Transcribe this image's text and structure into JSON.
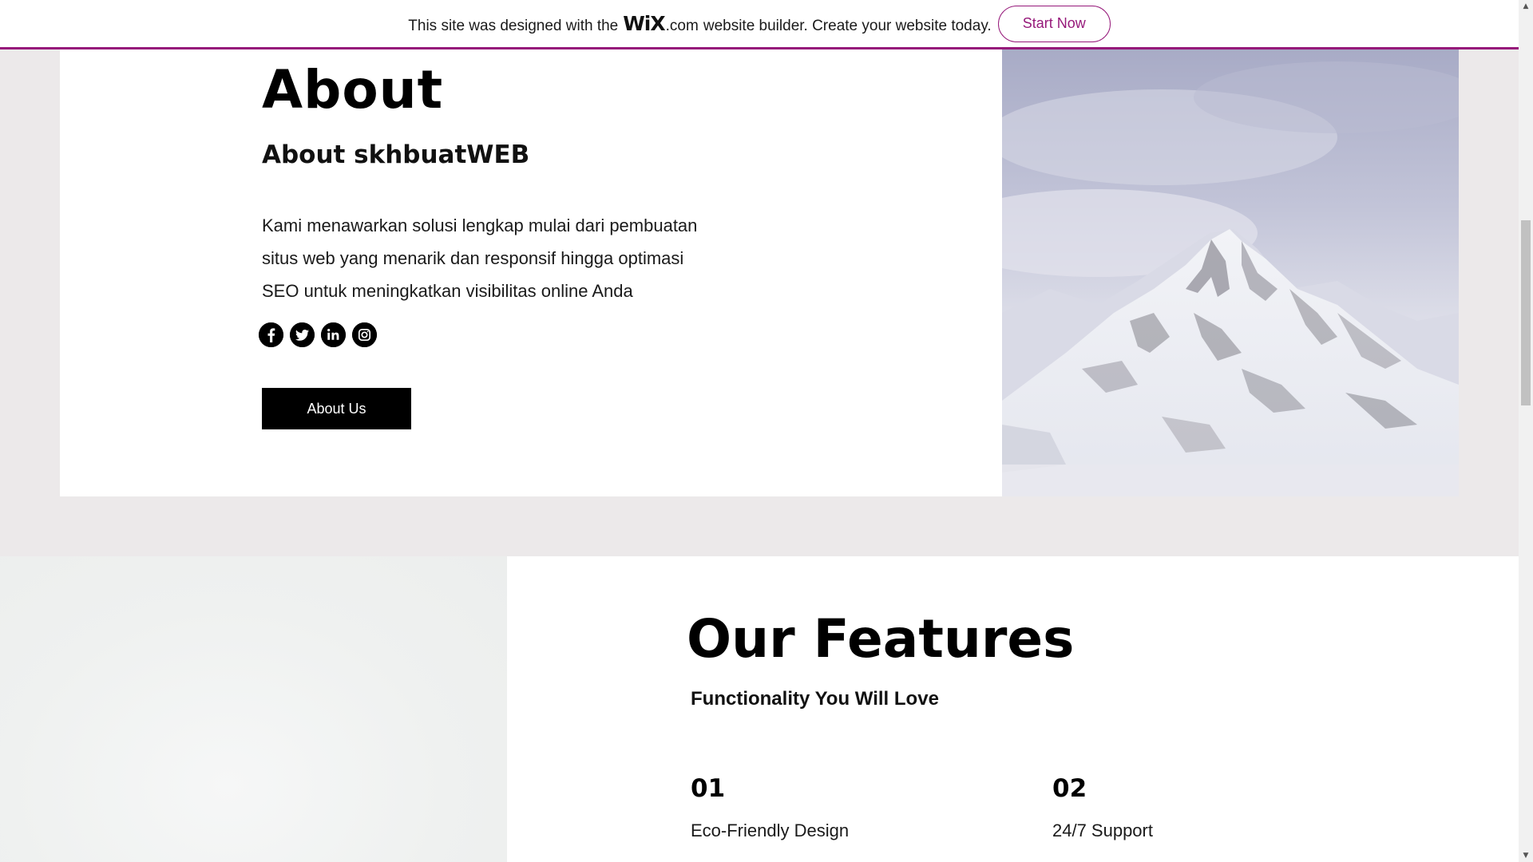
{
  "banner": {
    "text_before": "This site was designed with the",
    "logo_text": "WiX",
    "logo_suffix": ".com",
    "text_after": "website builder. Create your website today.",
    "cta_label": "Start Now",
    "accent_color": "#96197a"
  },
  "about": {
    "heading": "About",
    "subheading": "About skhbuatWEB",
    "body": "Kami menawarkan solusi lengkap mulai dari pembuatan situs web yang menarik dan responsif hingga optimasi SEO untuk meningkatkan visibilitas online Anda",
    "social_icons": [
      "facebook-icon",
      "twitter-icon",
      "linkedin-icon",
      "instagram-icon"
    ],
    "button_label": "About Us"
  },
  "features": {
    "heading": "Our Features",
    "subheading": "Functionality You Will Love",
    "items": [
      {
        "number": "01",
        "title": "Eco-Friendly Design"
      },
      {
        "number": "02",
        "title": "24/7 Support"
      }
    ]
  },
  "scrollbar": {
    "up_icon": "arrow-up-icon",
    "down_icon": "arrow-down-icon"
  }
}
